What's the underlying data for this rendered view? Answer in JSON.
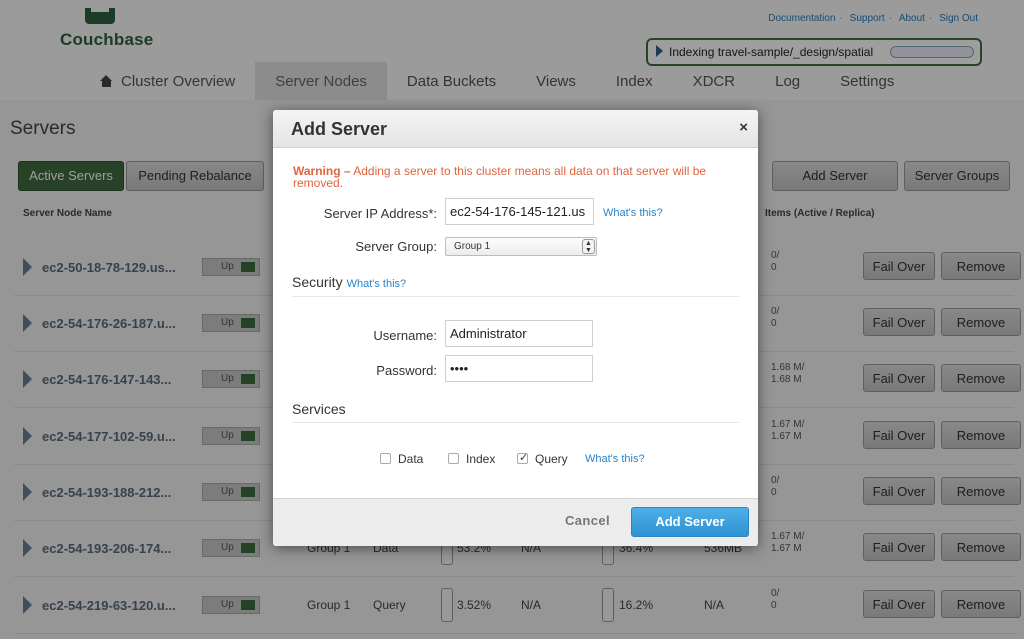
{
  "app": {
    "logo_text": "Couchbase",
    "top_links": [
      "Documentation",
      "Support",
      "About",
      "Sign Out"
    ],
    "indexing_status": "Indexing travel-sample/_design/spatial",
    "nav": [
      "Cluster Overview",
      "Server Nodes",
      "Data Buckets",
      "Views",
      "Index",
      "XDCR",
      "Log",
      "Settings"
    ],
    "page_title": "Servers",
    "tabs": {
      "active": "Active Servers",
      "pending": "Pending Rebalance"
    },
    "actions": {
      "add_server": "Add Server",
      "server_groups": "Server Groups"
    },
    "columns": {
      "name": "Server Node Name",
      "items": "Items (Active / Replica)"
    },
    "row_buttons": {
      "fail_over": "Fail Over",
      "remove": "Remove",
      "status": "Up"
    },
    "rows": [
      {
        "name": "ec2-50-18-78-129.us...",
        "items_active": "0/",
        "items_replica": "0"
      },
      {
        "name": "ec2-54-176-26-187.u...",
        "items_active": "0/",
        "items_replica": "0"
      },
      {
        "name": "ec2-54-176-147-143...",
        "items_active": "1.68 M/",
        "items_replica": "1.68 M"
      },
      {
        "name": "ec2-54-177-102-59.u...",
        "items_active": "1.67 M/",
        "items_replica": "1.67 M"
      },
      {
        "name": "ec2-54-193-188-212...",
        "items_active": "0/",
        "items_replica": "0"
      },
      {
        "name": "ec2-54-193-206-174...",
        "items_active": "1.67 M/",
        "items_replica": "1.67 M",
        "group": "Group 1",
        "services": "Data",
        "cpu": "53.2%",
        "swap": "N/A",
        "ram": "36.4%",
        "disk": "536MB"
      },
      {
        "name": "ec2-54-219-63-120.u...",
        "items_active": "0/",
        "items_replica": "0",
        "group": "Group 1",
        "services": "Query",
        "cpu": "3.52%",
        "swap": "N/A",
        "ram": "16.2%",
        "disk": "N/A"
      }
    ]
  },
  "dialog": {
    "title": "Add Server",
    "close": "×",
    "warning_prefix": "Warning –",
    "warning_text": "Adding a server to this cluster means all data on that server will be removed.",
    "ip_label": "Server IP Address*:",
    "ip_value": "ec2-54-176-145-121.us",
    "whats_this": "What's this?",
    "group_label": "Server Group:",
    "group_value": "Group 1",
    "security_title": "Security",
    "username_label": "Username:",
    "username_value": "Administrator",
    "password_label": "Password:",
    "password_value": "••••",
    "services_title": "Services",
    "services": [
      {
        "label": "Data",
        "checked": false
      },
      {
        "label": "Index",
        "checked": false
      },
      {
        "label": "Query",
        "checked": true
      }
    ],
    "cancel": "Cancel",
    "submit": "Add Server"
  },
  "colors": {
    "brand_green": "#2e5f3e",
    "warning": "#e0643e",
    "link": "#2a85c8",
    "primary_button": "#3aa2dd"
  }
}
